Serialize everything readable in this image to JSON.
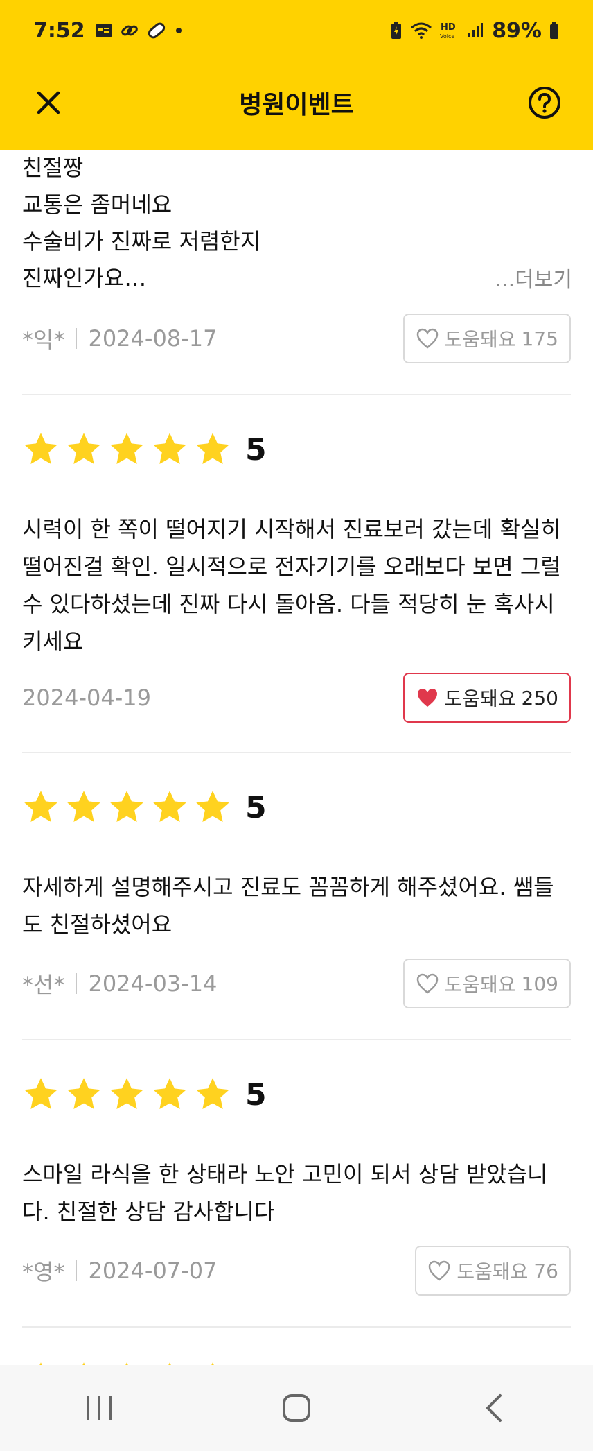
{
  "status_bar": {
    "time": "7:52",
    "battery": "89%"
  },
  "header": {
    "title": "병원이벤트"
  },
  "reviews": [
    {
      "lines": [
        "친절짱",
        "교통은 좀머네요",
        "수술비가 진짜로 저렴한지",
        "진짜인가요…"
      ],
      "more": "...더보기",
      "author": "*익*",
      "date": "2024-08-17",
      "helpful_label": "도움돼요",
      "helpful_count": "175",
      "liked": false
    },
    {
      "score": "5",
      "text": "시력이 한 쪽이 떨어지기 시작해서 진료보러 갔는데 확실히 떨어진걸 확인. 일시적으로 전자기기를 오래보다 보면 그럴 수 있다하셨는데 진짜 다시 돌아옴. 다들 적당히 눈 혹사시키세요",
      "date": "2024-04-19",
      "helpful_label": "도움돼요",
      "helpful_count": "250",
      "liked": true
    },
    {
      "score": "5",
      "text": "자세하게 설명해주시고 진료도 꼼꼼하게 해주셨어요. 쌤들도 친절하셨어요",
      "author": "*선*",
      "date": "2024-03-14",
      "helpful_label": "도움돼요",
      "helpful_count": "109",
      "liked": false
    },
    {
      "score": "5",
      "text": "스마일 라식을 한 상태라 노안 고민이 되서 상담 받았습니다. 친절한 상담 감사합니다",
      "author": "*영*",
      "date": "2024-07-07",
      "helpful_label": "도움돼요",
      "helpful_count": "76",
      "liked": false
    }
  ],
  "colors": {
    "accent": "#FFD200",
    "star": "#FFD21F",
    "heart": "#E0384C"
  }
}
